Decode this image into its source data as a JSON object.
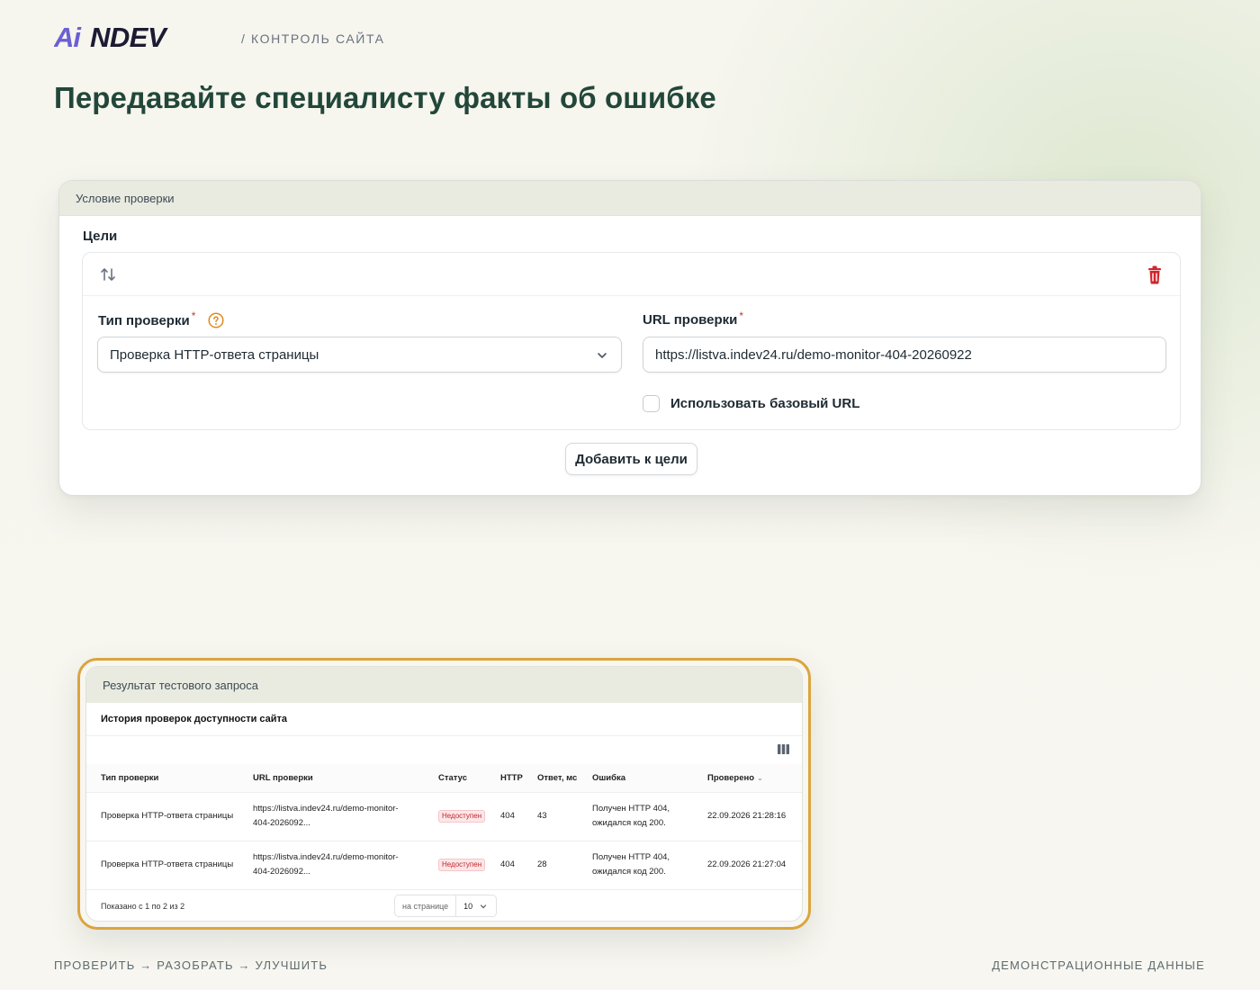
{
  "brand": {
    "logo_text": "AiNDEV",
    "crumb": "/ КОНТРОЛЬ САЙТА",
    "logo_colors": {
      "accent": "#6b5fd3",
      "dark": "#1c1b33"
    }
  },
  "page": {
    "title": "Передавайте специалисту факты об ошибке"
  },
  "condition": {
    "header": "Условие проверки",
    "goals_label": "Цели",
    "type_label": "Тип проверки",
    "type_value": "Проверка HTTP-ответа страницы",
    "url_label": "URL проверки",
    "url_value": "https://listva.indev24.ru/demo-monitor-404-20260922",
    "required_mark": "*",
    "base_url_label": "Использовать базовый URL",
    "base_url_checked": false,
    "add_button": "Добавить к цели"
  },
  "result": {
    "header": "Результат тестового запроса",
    "history_title": "История проверок доступности сайта",
    "columns": [
      "Тип проверки",
      "URL проверки",
      "Статус",
      "HTTP",
      "Ответ, мс",
      "Ошибка",
      "Проверено"
    ],
    "sorted_column": "Проверено",
    "rows": [
      {
        "type": "Проверка HTTP-ответа страницы",
        "url_line1": "https://listva.indev24.ru/demo-monitor-",
        "url_line2": "404-2026092...",
        "status": "Недоступен",
        "http": "404",
        "ms": "43",
        "error_line1": "Получен HTTP 404,",
        "error_line2": "ожидался код 200.",
        "checked": "22.09.2026 21:28:16"
      },
      {
        "type": "Проверка HTTP-ответа страницы",
        "url_line1": "https://listva.indev24.ru/demo-monitor-",
        "url_line2": "404-2026092...",
        "status": "Недоступен",
        "http": "404",
        "ms": "28",
        "error_line1": "Получен HTTP 404,",
        "error_line2": "ожидался код 200.",
        "checked": "22.09.2026 21:27:04"
      }
    ],
    "shown_text": "Показано с 1 по 2 из 2",
    "per_page_label": "на странице",
    "per_page_value": "10"
  },
  "footer": {
    "left": "ПРОВЕРИТЬ → РАЗОБРАТЬ → УЛУЧШИТЬ",
    "right": "ДЕМОНСТРАЦИОННЫЕ ДАННЫЕ"
  },
  "colors": {
    "title_green": "#22473a",
    "highlight_border": "#dba43e",
    "danger": "#d0342c",
    "help_orange": "#e08a1e"
  }
}
